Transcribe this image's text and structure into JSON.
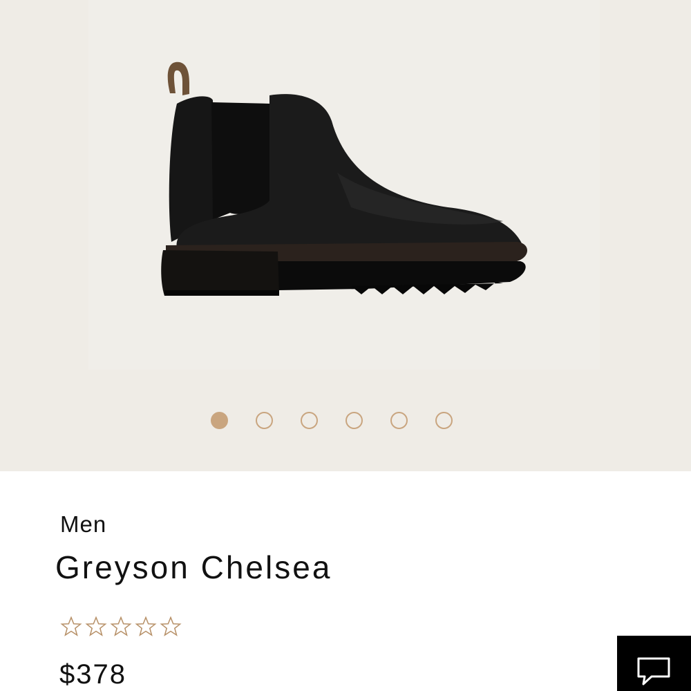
{
  "gallery": {
    "image_alt": "Greyson Chelsea black leather boot",
    "dots": [
      {
        "active": true
      },
      {
        "active": false
      },
      {
        "active": false
      },
      {
        "active": false
      },
      {
        "active": false
      },
      {
        "active": false
      }
    ]
  },
  "product": {
    "category": "Men",
    "title": "Greyson Chelsea",
    "rating": 0,
    "rating_max": 5,
    "price": "$378"
  },
  "colors": {
    "accent": "#c9a57f",
    "star_outline": "#b8926a",
    "background": "#efece6"
  },
  "icons": {
    "chat": "chat-bubble-icon",
    "star": "star-outline-icon"
  }
}
